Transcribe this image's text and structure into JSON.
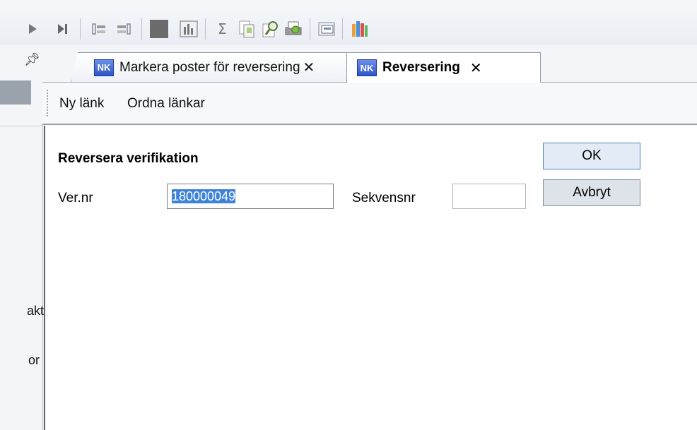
{
  "toolbar": {
    "icons": [
      "play-icon",
      "skip-end-icon",
      "align-left-icon",
      "align-right-icon",
      "stop-icon",
      "bar-chart-icon",
      "sigma-icon",
      "copy-icon",
      "search-doc-icon",
      "print-icon",
      "window-icon",
      "library-icon"
    ]
  },
  "sidebar": {
    "partial_label_1": "akt",
    "partial_label_2": "or"
  },
  "tabs": [
    {
      "badge": "NK",
      "label": "Markera poster för reversering",
      "active": false
    },
    {
      "badge": "NK",
      "label": "Reversering",
      "active": true
    }
  ],
  "links": {
    "new_link": "Ny länk",
    "arrange_links": "Ordna länkar"
  },
  "form": {
    "heading": "Reversera verifikation",
    "ver_label": "Ver.nr",
    "ver_value": "180000049",
    "seq_label": "Sekvensnr",
    "seq_value": "",
    "ok_label": "OK",
    "cancel_label": "Avbryt"
  },
  "colors": {
    "selection": "#3f83d8",
    "ok_border": "#4a82cf",
    "badge": "#2f55c9"
  }
}
